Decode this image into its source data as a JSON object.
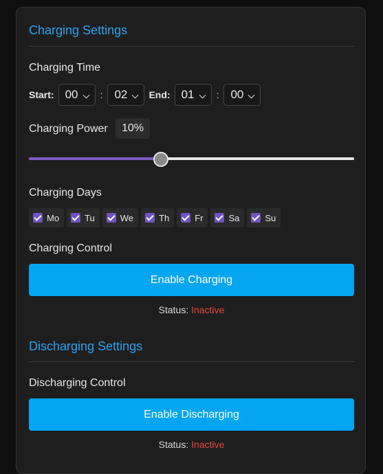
{
  "charging": {
    "title": "Charging Settings",
    "time_label": "Charging Time",
    "start_label": "Start:",
    "end_label": "End:",
    "colon": ":",
    "start_hour": "00",
    "start_minute": "02",
    "end_hour": "01",
    "end_minute": "00",
    "power_label": "Charging Power",
    "power_value": "10%",
    "power_fraction": 0.405,
    "days_label": "Charging Days",
    "days": [
      {
        "label": "Mo",
        "checked": true
      },
      {
        "label": "Tu",
        "checked": true
      },
      {
        "label": "We",
        "checked": true
      },
      {
        "label": "Th",
        "checked": true
      },
      {
        "label": "Fr",
        "checked": true
      },
      {
        "label": "Sa",
        "checked": true
      },
      {
        "label": "Su",
        "checked": true
      }
    ],
    "control_label": "Charging Control",
    "button_label": "Enable Charging",
    "status_label": "Status:",
    "status_value": "Inactive"
  },
  "discharging": {
    "title": "Discharging Settings",
    "control_label": "Discharging Control",
    "button_label": "Enable Discharging",
    "status_label": "Status:",
    "status_value": "Inactive"
  },
  "colors": {
    "accent": "#2aa3f0",
    "button": "#04a6f2",
    "slider_fill": "#7c5cbf",
    "status_inactive": "#e5483a"
  }
}
